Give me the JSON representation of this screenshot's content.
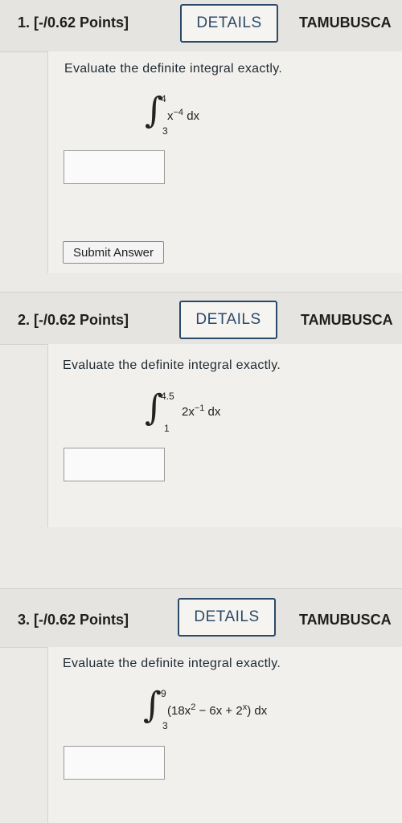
{
  "questions": [
    {
      "number_label": "1. [-/0.62 Points]",
      "details_label": "DETAILS",
      "course_label": "TAMUBUSCA",
      "prompt": "Evaluate the definite integral exactly.",
      "upper": "4",
      "lower": "3",
      "integrand_html_parts": [
        "x",
        "−4",
        " dx"
      ],
      "submit_label": "Submit Answer"
    },
    {
      "number_label": "2. [-/0.62 Points]",
      "details_label": "DETAILS",
      "course_label": "TAMUBUSCA",
      "prompt": "Evaluate the definite integral exactly.",
      "upper": "4.5",
      "lower": "1",
      "integrand_html_parts": [
        "2x",
        "−1",
        " dx"
      ]
    },
    {
      "number_label": "3. [-/0.62 Points]",
      "details_label": "DETAILS",
      "course_label": "TAMUBUSCA",
      "prompt": "Evaluate the definite integral exactly.",
      "upper": "9",
      "lower": "3",
      "integrand_parts": [
        "(18x",
        "2",
        " − 6x + 2",
        "x",
        ") dx"
      ]
    }
  ]
}
